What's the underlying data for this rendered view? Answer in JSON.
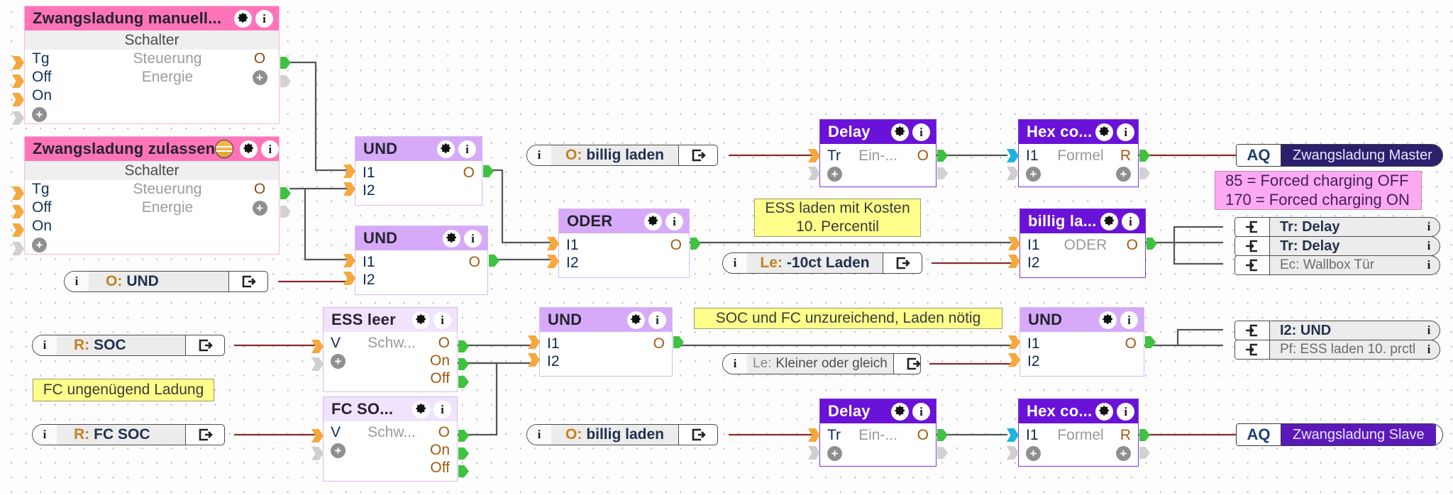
{
  "switch_nodes": [
    {
      "title": "Zwangsladung  manuell...",
      "subtitle": "Schalter",
      "has_sun_icon": false,
      "rows": [
        {
          "left": "Tg",
          "mid": "Steuerung",
          "right": "O"
        },
        {
          "left": "Off",
          "mid": "Energie",
          "right": "plus"
        },
        {
          "left": "On",
          "mid": "",
          "right": ""
        }
      ],
      "add_label": "+"
    },
    {
      "title": "Zwangsladung zulassen",
      "subtitle": "Schalter",
      "has_sun_icon": true,
      "rows": [
        {
          "left": "Tg",
          "mid": "Steuerung",
          "right": "O"
        },
        {
          "left": "Off",
          "mid": "Energie",
          "right": "plus"
        },
        {
          "left": "On",
          "mid": "",
          "right": ""
        }
      ],
      "add_label": "+"
    }
  ],
  "logic_nodes": {
    "und_top": {
      "title": "UND",
      "in1": "I1",
      "in2": "I2",
      "out": "O"
    },
    "und_second": {
      "title": "UND",
      "in1": "I1",
      "in2": "I2",
      "out": "O"
    },
    "oder": {
      "title": "ODER",
      "in1": "I1",
      "in2": "I2",
      "out": "O"
    },
    "und_mid": {
      "title": "UND",
      "in1": "I1",
      "in2": "I2",
      "out": "O"
    },
    "und_right": {
      "title": "UND",
      "in1": "I1",
      "in2": "I2",
      "out": "O"
    },
    "ess_leer": {
      "title": "ESS leer",
      "left": "V",
      "mid": "Schw...",
      "out": "O",
      "on": "On",
      "off": "Off"
    },
    "fc_soc": {
      "title": "FC SO...",
      "left": "V",
      "mid": "Schw...",
      "out": "O",
      "on": "On",
      "off": "Off"
    }
  },
  "dark_nodes": {
    "delay_top": {
      "title": "Delay",
      "left": "Tr",
      "mid": "Ein-...",
      "out": "O"
    },
    "hex_top": {
      "title": "Hex  co...",
      "left": "I1",
      "mid": "Formel",
      "out": "R"
    },
    "billig": {
      "title": "billig la...",
      "left": "I1",
      "mid": "ODER",
      "out": "O",
      "in2": "I2"
    },
    "delay_bottom": {
      "title": "Delay",
      "left": "Tr",
      "mid": "Ein-...",
      "out": "O"
    },
    "hex_bottom": {
      "title": "Hex  co...",
      "left": "I1",
      "mid": "Formel",
      "out": "R"
    }
  },
  "pills": [
    {
      "id": "o_billig_top",
      "prefix": "O:",
      "text": "billig laden",
      "bold": true
    },
    {
      "id": "o_und",
      "prefix": "O:",
      "text": "UND",
      "bold": true
    },
    {
      "id": "le_10ct",
      "prefix": "Le:",
      "text": "-10ct Laden",
      "bold": true
    },
    {
      "id": "r_soc",
      "prefix": "R:",
      "text": "SOC",
      "bold": true
    },
    {
      "id": "le_kleiner",
      "prefix": "Le:",
      "text": "Kleiner oder gleich",
      "bold": false
    },
    {
      "id": "r_fc_soc",
      "prefix": "R:",
      "text": "FC SOC",
      "bold": true
    },
    {
      "id": "o_billig_bottom",
      "prefix": "O:",
      "text": "billig laden",
      "bold": true
    }
  ],
  "link_rows": [
    {
      "id": "tr_delay_1",
      "text": "Tr: Delay",
      "dim": false
    },
    {
      "id": "tr_delay_2",
      "text": "Tr: Delay",
      "dim": false
    },
    {
      "id": "ec_wallbox",
      "text": "Ec: Wallbox Tür",
      "dim": true
    },
    {
      "id": "i2_und",
      "text": "I2: UND",
      "dim": false
    },
    {
      "id": "pf_ess",
      "text": "Pf: ESS laden 10. prctl",
      "dim": true
    }
  ],
  "outputs": [
    {
      "id": "aq_master",
      "tag": "AQ",
      "name": "Zwangsladung Master",
      "color": "#2b1f6e"
    },
    {
      "id": "aq_slave",
      "tag": "AQ",
      "name": "Zwangsladung Slave",
      "color": "#5c19ba"
    }
  ],
  "comments": [
    {
      "id": "cmt_ess_kosten",
      "lines": [
        "ESS laden mit Kosten",
        "10. Percentil"
      ],
      "style": "yellow"
    },
    {
      "id": "cmt_soc_fc",
      "lines": [
        "SOC und FC unzureichend, Laden nötig"
      ],
      "style": "yellow"
    },
    {
      "id": "cmt_fc_ungenuegend",
      "lines": [
        "FC ungenügend Ladung"
      ],
      "style": "yellow"
    },
    {
      "id": "cmt_forced_charging",
      "lines": [
        "85 = Forced charging OFF",
        "170 = Forced charging ON"
      ],
      "style": "pink"
    }
  ],
  "colors": {
    "switch_header": "#ff74b9",
    "logic_header": "#d6aaf8",
    "logic_header_pale": "#f0e3fb",
    "dark_header": "#6a12d8",
    "comment_yellow": "#ffff8c",
    "comment_pink": "#ffa9f2",
    "port_in": "#f5a83c",
    "port_out": "#3fc23f",
    "wire_grey": "#555555",
    "wire_red": "#8b2b2b"
  }
}
